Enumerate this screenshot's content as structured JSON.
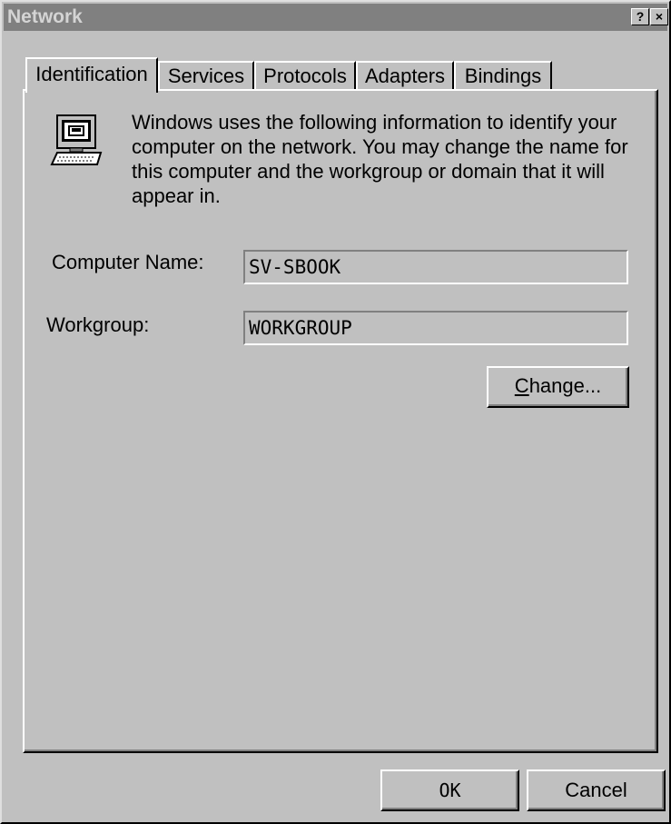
{
  "window": {
    "title": "Network",
    "help_glyph": "?",
    "close_glyph": "×"
  },
  "tabs": [
    {
      "label": "Identification",
      "active": true
    },
    {
      "label": "Services",
      "active": false
    },
    {
      "label": "Protocols",
      "active": false
    },
    {
      "label": "Adapters",
      "active": false
    },
    {
      "label": "Bindings",
      "active": false
    }
  ],
  "identification": {
    "icon": "computer-icon",
    "description": "Windows uses the following information to identify your computer on the network.  You may change the name for this computer and the workgroup or domain that it will appear in.",
    "computer_name_label": "Computer Name:",
    "computer_name_value": "SV-SBOOK",
    "workgroup_label": "Workgroup:",
    "workgroup_value": "WORKGROUP",
    "change_button": {
      "mnemonic": "C",
      "rest": "hange..."
    }
  },
  "footer": {
    "ok_label": "OK",
    "cancel_label": "Cancel"
  }
}
